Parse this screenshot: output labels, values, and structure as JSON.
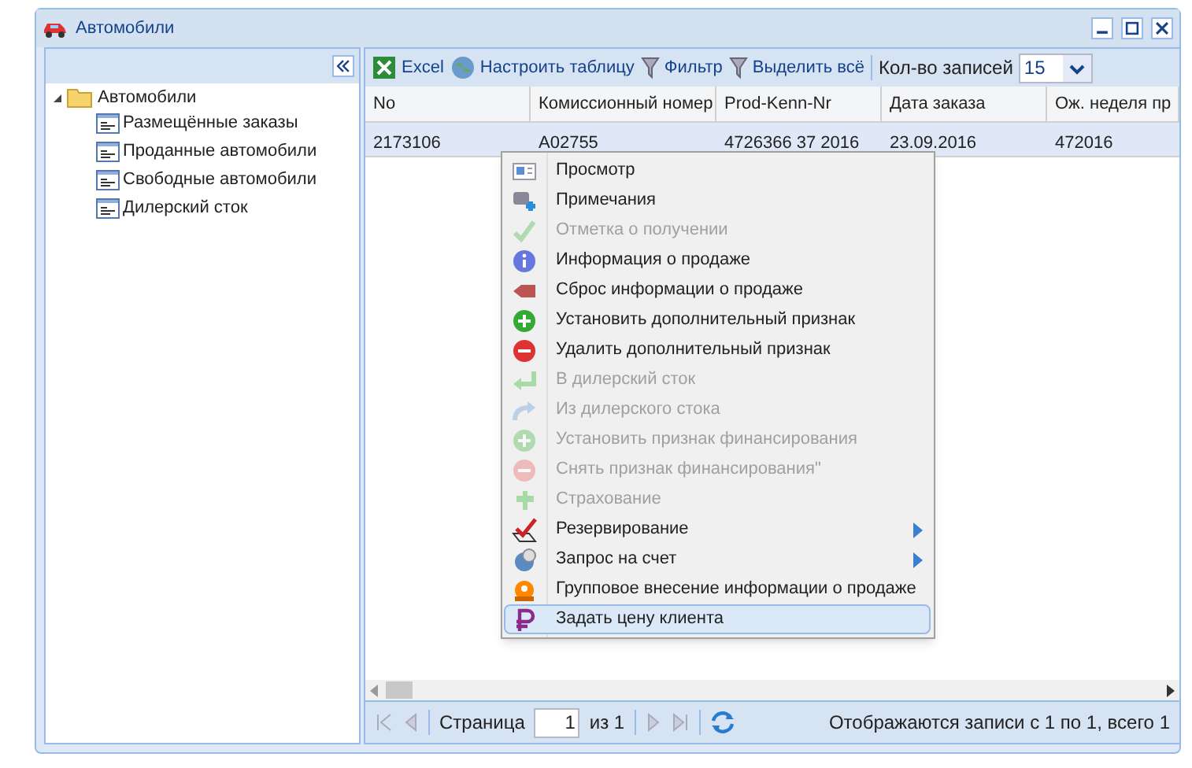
{
  "window": {
    "title": "Автомобили"
  },
  "tree": {
    "label": "Автомобили",
    "expanded": true,
    "children": [
      {
        "label": "Размещённые заказы"
      },
      {
        "label": "Проданные автомобили"
      },
      {
        "label": "Свободные автомобили"
      },
      {
        "label": "Дилерский сток"
      }
    ]
  },
  "toolbar": {
    "buttons": [
      "Excel",
      "Настроить таблицу",
      "Фильтр",
      "Выделить всё"
    ],
    "page_size_label": "Кол-во записей",
    "page_size": "15"
  },
  "table": {
    "columns": [
      "No",
      "Комиссионный номер",
      "Prod-Kenn-Nr",
      "Дата заказа",
      "Ож. неделя пр"
    ],
    "rows": [
      {
        "selected": true,
        "cells": [
          "2173106",
          "A02755",
          "4726366 37 2016",
          "23.09.2016",
          "472016"
        ]
      }
    ]
  },
  "context_menu": [
    {
      "label": "Просмотр",
      "disabled": false,
      "submenu": false,
      "selected": false
    },
    {
      "label": "Примечания",
      "disabled": false,
      "submenu": false,
      "selected": false
    },
    {
      "label": "Отметка о получении",
      "disabled": true,
      "submenu": false,
      "selected": false
    },
    {
      "label": "Информация о продаже",
      "disabled": false,
      "submenu": false,
      "selected": false
    },
    {
      "label": "Сброс информации о продаже",
      "disabled": false,
      "submenu": false,
      "selected": false
    },
    {
      "label": "Установить дополнительный признак",
      "disabled": false,
      "submenu": false,
      "selected": false
    },
    {
      "label": "Удалить дополнительный признак",
      "disabled": false,
      "submenu": false,
      "selected": false
    },
    {
      "label": "В дилерский сток",
      "disabled": true,
      "submenu": false,
      "selected": false
    },
    {
      "label": "Из дилерского стока",
      "disabled": true,
      "submenu": false,
      "selected": false
    },
    {
      "label": "Установить признак финансирования",
      "disabled": true,
      "submenu": false,
      "selected": false
    },
    {
      "label": "Снять признак финансирования\"",
      "disabled": true,
      "submenu": false,
      "selected": false
    },
    {
      "label": "Страхование",
      "disabled": true,
      "submenu": false,
      "selected": false
    },
    {
      "label": "Резервирование",
      "disabled": false,
      "submenu": true,
      "selected": false
    },
    {
      "label": "Запрос на счет",
      "disabled": false,
      "submenu": true,
      "selected": false
    },
    {
      "label": "Групповое внесение информации о продаже",
      "disabled": false,
      "submenu": false,
      "selected": false
    },
    {
      "label": "Задать цену клиента",
      "disabled": false,
      "submenu": false,
      "selected": true
    }
  ],
  "pagination": {
    "page_label": "Страница",
    "page": "1",
    "of_label": "из 1",
    "summary": "Отображаются записи с 1 по 1, всего 1"
  }
}
